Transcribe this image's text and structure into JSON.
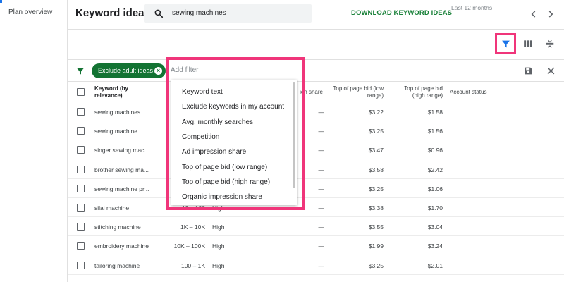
{
  "sidebar": {
    "items": [
      {
        "label": "Plan overview"
      }
    ]
  },
  "header": {
    "title": "Keyword ideas",
    "search_value": "sewing machines",
    "download_label": "DOWNLOAD KEYWORD IDEAS",
    "date_range": "Last 12 months"
  },
  "filter_bar": {
    "chip_label": "Exclude adult ideas",
    "add_filter_placeholder": "Add filter"
  },
  "table": {
    "headers": {
      "keyword": "Keyword (by relevance)",
      "ad_impression_share": "ion share",
      "bid_low": "Top of page bid (low range)",
      "bid_high": "Top of page bid (high range)",
      "account_status": "Account status"
    },
    "rows": [
      {
        "keyword": "sewing machines",
        "searches": "",
        "competition": "",
        "impression_share": "—",
        "bid_low": "$3.22",
        "bid_high": "$1.58"
      },
      {
        "keyword": "sewing machine",
        "searches": "",
        "competition": "",
        "impression_share": "—",
        "bid_low": "$3.25",
        "bid_high": "$1.56"
      },
      {
        "keyword": "singer sewing mac...",
        "searches": "",
        "competition": "",
        "impression_share": "—",
        "bid_low": "$3.47",
        "bid_high": "$0.96"
      },
      {
        "keyword": "brother sewing ma...",
        "searches": "",
        "competition": "",
        "impression_share": "—",
        "bid_low": "$3.58",
        "bid_high": "$2.42"
      },
      {
        "keyword": "sewing machine pr...",
        "searches": "",
        "competition": "",
        "impression_share": "—",
        "bid_low": "$3.25",
        "bid_high": "$1.06"
      },
      {
        "keyword": "silai machine",
        "searches": "10 – 100",
        "competition": "High",
        "impression_share": "—",
        "bid_low": "$3.38",
        "bid_high": "$1.70"
      },
      {
        "keyword": "stitching machine",
        "searches": "1K – 10K",
        "competition": "High",
        "impression_share": "—",
        "bid_low": "$3.55",
        "bid_high": "$3.04"
      },
      {
        "keyword": "embroidery machine",
        "searches": "10K – 100K",
        "competition": "High",
        "impression_share": "—",
        "bid_low": "$1.99",
        "bid_high": "$3.24"
      },
      {
        "keyword": "tailoring machine",
        "searches": "100 – 1K",
        "competition": "High",
        "impression_share": "—",
        "bid_low": "$3.25",
        "bid_high": "$2.01"
      }
    ]
  },
  "dropdown": {
    "items": [
      "Keyword text",
      "Exclude keywords in my account",
      "Avg. monthly searches",
      "Competition",
      "Ad impression share",
      "Top of page bid (low range)",
      "Top of page bid (high range)",
      "Organic impression share"
    ]
  },
  "colors": {
    "accent_green": "#137333",
    "download_green": "#188038",
    "highlight_pink": "#f0357a",
    "filter_blue": "#1a73e8"
  },
  "icons": [
    "search-icon",
    "chevron-left-icon",
    "chevron-right-icon",
    "filter-icon",
    "columns-icon",
    "expand-icon",
    "save-icon",
    "close-icon"
  ]
}
